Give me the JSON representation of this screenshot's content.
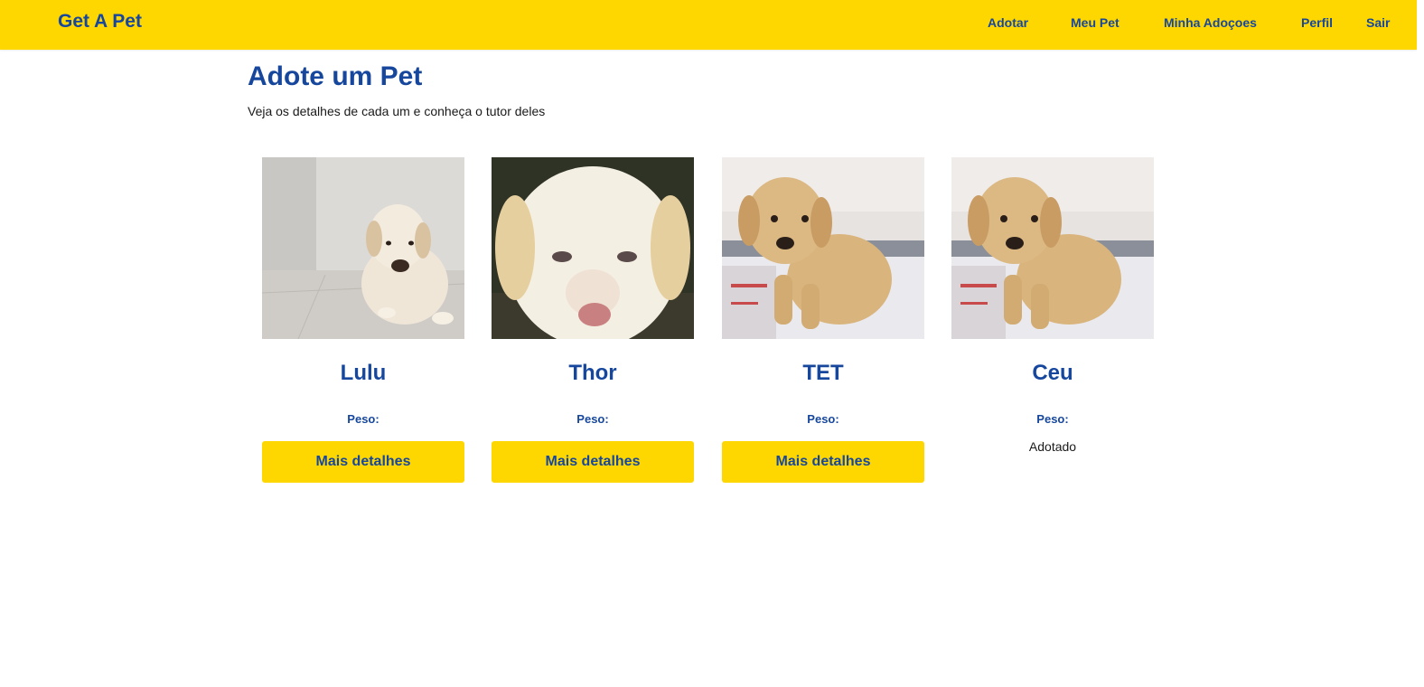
{
  "navbar": {
    "brand": "Get A Pet",
    "links": [
      "Adotar",
      "Meu Pet",
      "Minha Adoçoes",
      "Perfil",
      "Sair"
    ],
    "background": "#ffd700",
    "text_color": "#16479d"
  },
  "main": {
    "title": "Adote um Pet",
    "subtitle": "Veja os detalhes de cada um e conheça o tutor deles"
  },
  "pets": [
    {
      "name": "Lulu",
      "weight_label": "Peso:",
      "action_label": "Mais detalhes"
    },
    {
      "name": "Thor",
      "weight_label": "Peso:",
      "action_label": "Mais detalhes"
    },
    {
      "name": "TET",
      "weight_label": "Peso:",
      "action_label": "Mais detalhes"
    },
    {
      "name": "Ceu",
      "weight_label": "Peso:",
      "status": "Adotado"
    }
  ]
}
